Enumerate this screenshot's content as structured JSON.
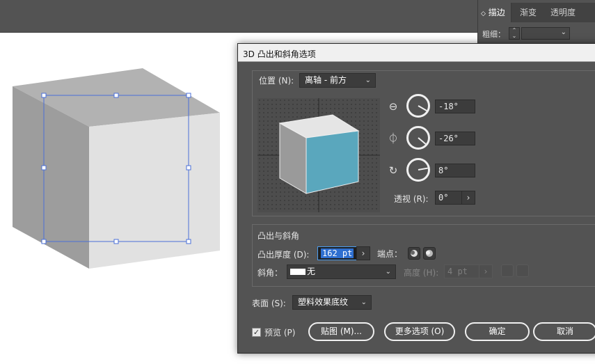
{
  "panel": {
    "tabs": [
      {
        "label": "描边",
        "active": true
      },
      {
        "label": "渐变",
        "active": false
      },
      {
        "label": "透明度",
        "active": false
      }
    ],
    "weight_label": "粗细："
  },
  "dialog": {
    "title": "3D 凸出和斜角选项",
    "position": {
      "label": "位置 (N):",
      "value": "离轴 - 前方"
    },
    "rotation": {
      "x_value": "-18°",
      "y_value": "-26°",
      "z_value": "8°"
    },
    "perspective": {
      "label": "透视 (R):",
      "value": "0°"
    },
    "extrude": {
      "section_title": "凸出与斜角",
      "depth_label": "凸出厚度 (D):",
      "depth_value": "162 pt",
      "cap_label": "端点：",
      "bevel_label": "斜角：",
      "bevel_value": "无",
      "height_label": "高度 (H):",
      "height_value": "4 pt"
    },
    "surface": {
      "label": "表面 (S):",
      "value": "塑料效果底纹"
    },
    "preview_label": "预览 (P)",
    "preview_checked": true,
    "buttons": {
      "map": "贴图 (M)...",
      "more_options": "更多选项 (O)",
      "ok": "确定",
      "cancel": "取消"
    }
  },
  "colors": {
    "cube_front": "#5aa7bd",
    "selection": "#4a6fd8",
    "dialog_bg": "#535353"
  }
}
